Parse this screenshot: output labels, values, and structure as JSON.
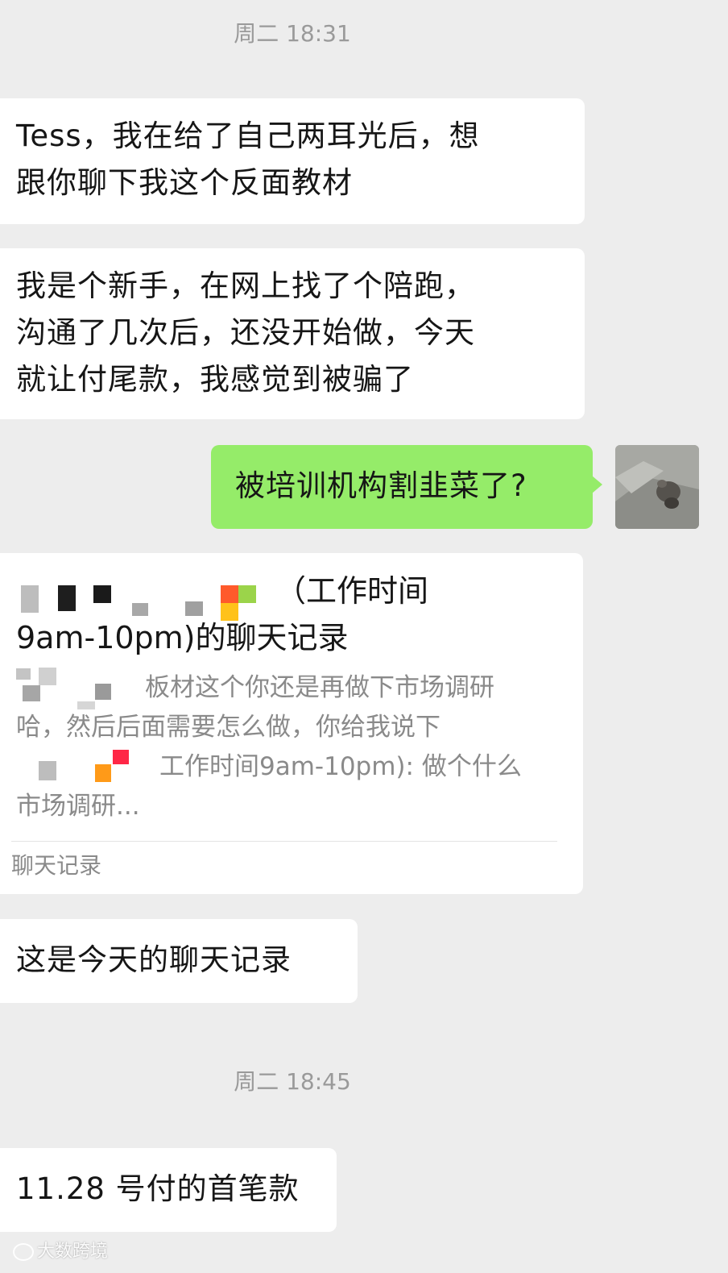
{
  "timestamps": {
    "first": "周二 18:31",
    "second": "周二 18:45"
  },
  "messages": {
    "msg1": {
      "line1": "Tess，我在给了自己两耳光后，想",
      "line2": "跟你聊下我这个反面教材"
    },
    "msg2": {
      "line1": "我是个新手，在网上找了个陪跑，",
      "line2": "沟通了几次后，还没开始做，今天",
      "line3": "就让付尾款，我感觉到被骗了"
    },
    "msg3": {
      "text": "被培训机构割韭菜了?"
    },
    "record": {
      "title_part1": "（工作时间",
      "title_part2": "9am-10pm)的聊天记录",
      "preview_line1": "板材这个你还是再做下市场调研",
      "preview_line2": "哈，然后后面需要怎么做，你给我说下",
      "preview_line3": "工作时间9am-10pm): 做个什么",
      "preview_line4": "市场调研...",
      "footer": "聊天记录"
    },
    "msg4": {
      "text": "这是今天的聊天记录"
    },
    "msg5": {
      "text": "11.28 号付的首笔款"
    }
  },
  "watermark": {
    "text": "大数跨境"
  },
  "colors": {
    "background": "#ededed",
    "bubble_incoming": "#ffffff",
    "bubble_outgoing": "#95ec69",
    "timestamp_text": "#9a9a9a",
    "preview_text": "#8a8a8a"
  },
  "icons": {
    "avatar": "cat-photo-avatar",
    "watermark_logo": "watermark-logo-icon"
  }
}
